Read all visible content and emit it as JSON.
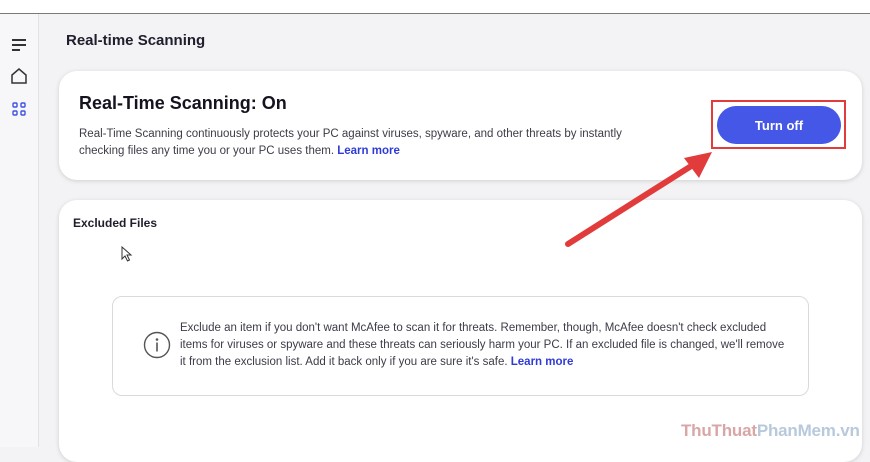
{
  "page": {
    "title": "Real-time Scanning"
  },
  "status_card": {
    "heading": "Real-Time Scanning: On",
    "description": "Real-Time Scanning continuously protects your PC against viruses, spyware, and other threats by instantly checking files any time you or your PC uses them.",
    "learn_more": "Learn more",
    "button_label": "Turn off"
  },
  "excluded_card": {
    "heading": "Excluded Files",
    "info_text": "Exclude an item if you don't want McAfee to scan it for threats. Remember, though, McAfee doesn't check excluded items for viruses or spyware and these threats can seriously harm your PC. If an excluded file is changed, we'll remove it from the exclusion list. Add it back only if you are sure it's safe.",
    "learn_more": "Learn more"
  },
  "sidebar": {
    "icons": [
      "menu-icon",
      "home-icon",
      "apps-grid-icon"
    ]
  },
  "watermark": {
    "part1": "ThuThuat",
    "part2": "PhanMem",
    "part3": ".vn"
  },
  "colors": {
    "accent": "#4557e6",
    "annotation": "#e23b3b",
    "link": "#2f3bd6"
  }
}
